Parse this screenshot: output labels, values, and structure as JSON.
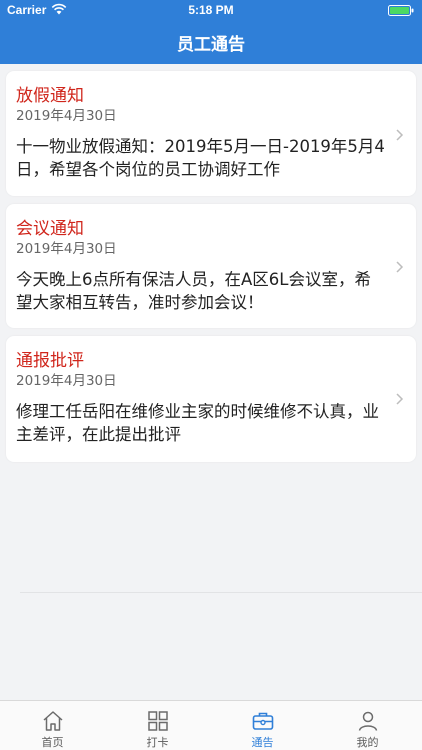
{
  "status_bar": {
    "carrier": "Carrier",
    "time": "5:18 PM"
  },
  "nav": {
    "title": "员工通告"
  },
  "notices": [
    {
      "title": "放假通知",
      "date": "2019年4月30日",
      "body": "十一物业放假通知：2019年5月一日-2019年5月4日，希望各个岗位的员工协调好工作"
    },
    {
      "title": "会议通知",
      "date": "2019年4月30日",
      "body": "今天晚上6点所有保洁人员，在A区6L会议室，希望大家相互转告，准时参加会议！"
    },
    {
      "title": "通报批评",
      "date": "2019年4月30日",
      "body": "修理工任岳阳在维修业主家的时候维修不认真，业主差评，在此提出批评"
    }
  ],
  "tabs": [
    {
      "label": "首页",
      "icon": "home-icon"
    },
    {
      "label": "打卡",
      "icon": "grid-icon"
    },
    {
      "label": "通告",
      "icon": "toolbox-icon",
      "active": true
    },
    {
      "label": "我的",
      "icon": "person-icon"
    }
  ],
  "colors": {
    "primary": "#2f7fd8",
    "title_red": "#d0261c",
    "background": "#f2f3f5"
  }
}
